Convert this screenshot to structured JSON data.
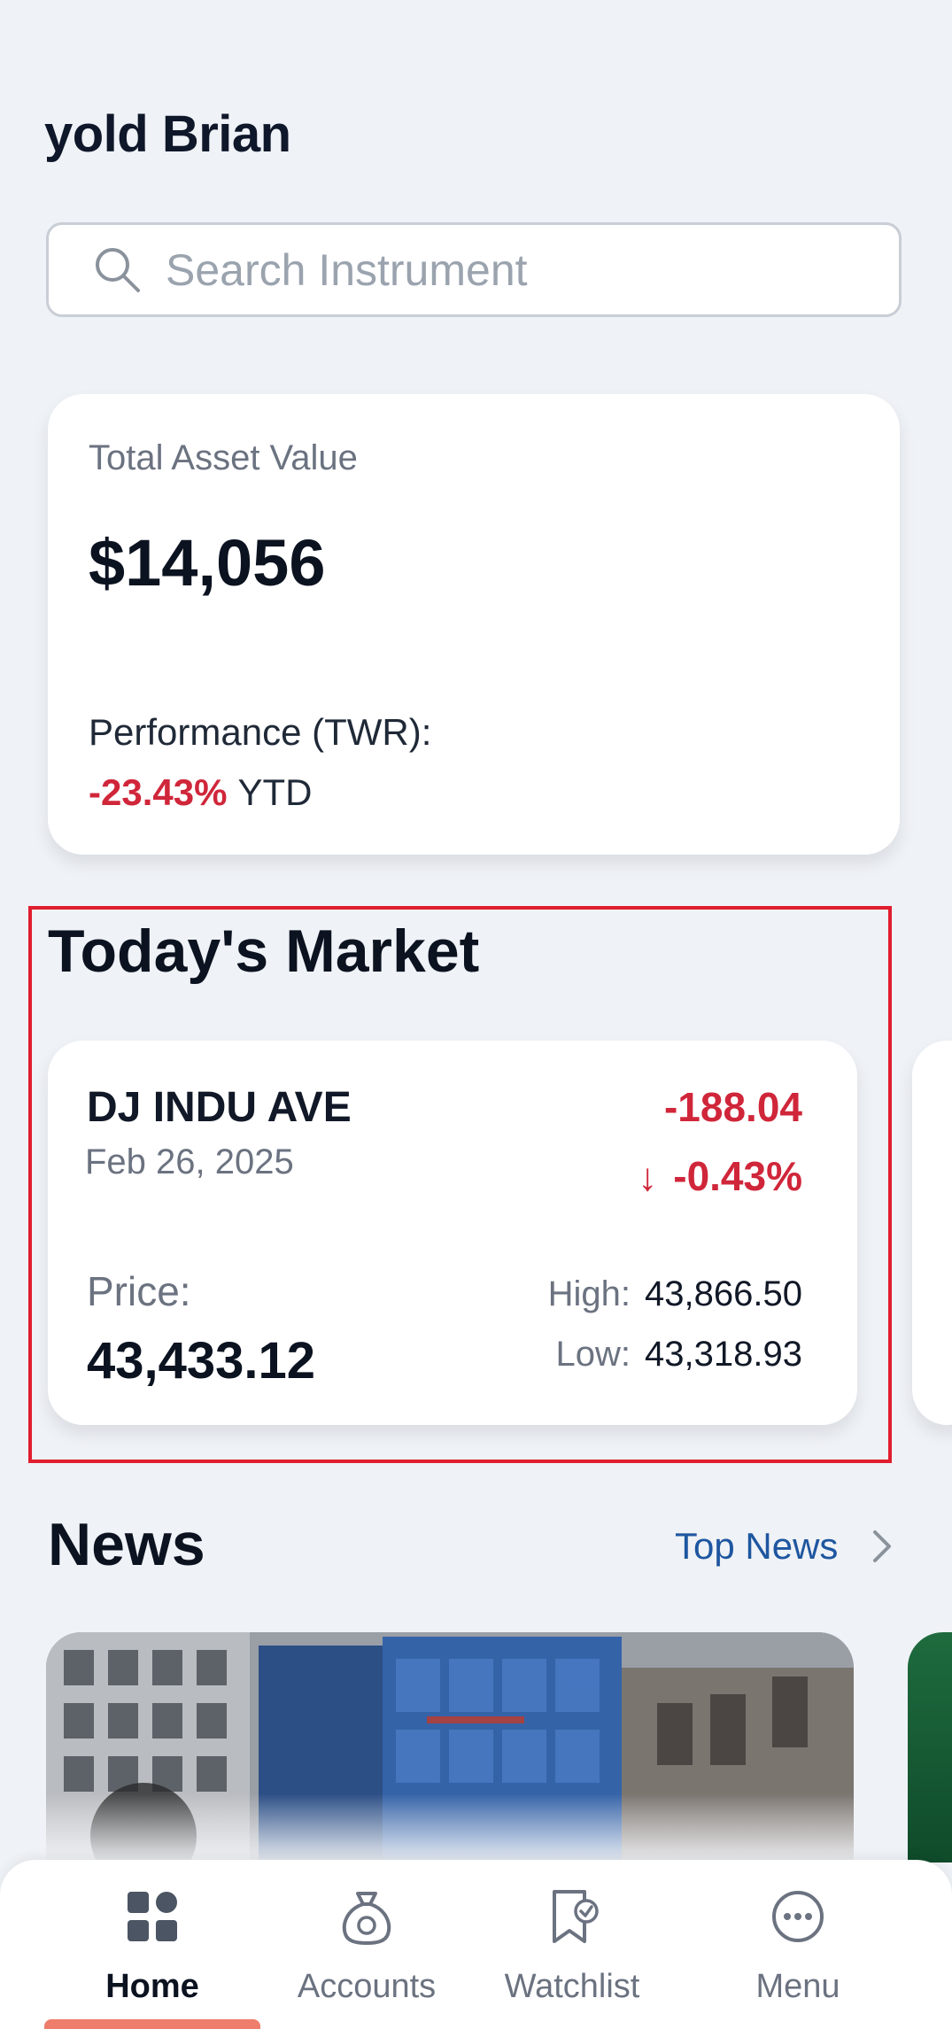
{
  "header": {
    "greeting": "yold Brian"
  },
  "search": {
    "placeholder": "Search Instrument",
    "value": ""
  },
  "asset": {
    "label": "Total Asset Value",
    "value": "$14,056",
    "performance_label": "Performance (TWR):",
    "performance_value": "-23.43%",
    "performance_period": "YTD"
  },
  "market": {
    "title": "Today's Market",
    "index": {
      "name": "DJ INDU AVE",
      "date": "Feb 26, 2025",
      "change": "-188.04",
      "change_arrow": "↓",
      "change_pct": "-0.43%",
      "price_label": "Price:",
      "price": "43,433.12",
      "high_label": "High:",
      "high": "43,866.50",
      "low_label": "Low:",
      "low": "43,318.93"
    }
  },
  "news": {
    "title": "News",
    "link_label": "Top News"
  },
  "nav": {
    "items": [
      {
        "label": "Home",
        "icon": "home-grid-icon",
        "active": true
      },
      {
        "label": "Accounts",
        "icon": "money-bag-icon",
        "active": false
      },
      {
        "label": "Watchlist",
        "icon": "bookmark-check-icon",
        "active": false
      },
      {
        "label": "Menu",
        "icon": "more-dots-icon",
        "active": false
      }
    ]
  },
  "colors": {
    "background": "#eff2f6",
    "negative": "#d0263a",
    "link": "#1e56a0",
    "nav_indicator": "#ee7d6b",
    "highlight_border": "#e01e2f"
  }
}
